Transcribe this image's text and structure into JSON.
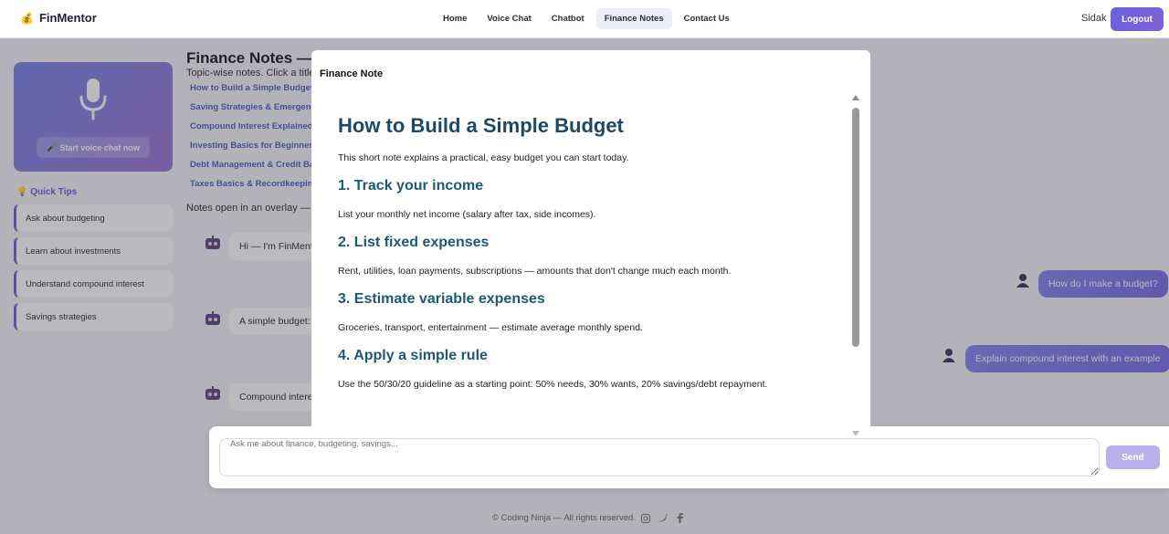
{
  "header": {
    "brand": "FinMentor",
    "nav": [
      "Home",
      "Voice Chat",
      "Chatbot",
      "Finance Notes",
      "Contact Us"
    ],
    "active_tab": "Finance Notes",
    "user_name": "Sidak",
    "logout_label": "Logout"
  },
  "voice_card": {
    "button_label": "Start voice chat now"
  },
  "quick_tips": {
    "title": "Quick Tips",
    "items": [
      "Ask about budgeting",
      "Learn about investments",
      "Understand compound interest",
      "Savings strategies"
    ]
  },
  "notes": {
    "title": "Finance Notes — I",
    "subtitle": "Topic-wise notes. Click a title",
    "topics": [
      "How to Build a Simple Budget",
      "Saving Strategies & Emergency",
      "Compound Interest Explained",
      "Investing Basics for Beginners",
      "Debt Management & Credit Bas",
      "Taxes Basics & Recordkeeping"
    ],
    "footer_text": "Notes open in an overlay —"
  },
  "chat": {
    "bot_messages": [
      "Hi — I'm FinMentor",
      "A simple budget:",
      "Compound intere"
    ],
    "user_messages": [
      "How do I make a budget?",
      "Explain compound interest with an example"
    ]
  },
  "input": {
    "placeholder": "Ask me about finance, budgeting, savings...",
    "send_label": "Send"
  },
  "footer": {
    "copyright": "© Coding Ninja — All rights reserved"
  },
  "modal": {
    "header": "Finance Note",
    "title": "How to Build a Simple Budget",
    "intro": "This short note explains a practical, easy budget you can start today.",
    "sections": [
      {
        "heading": "1. Track your income",
        "body": "List your monthly net income (salary after tax, side incomes)."
      },
      {
        "heading": "2. List fixed expenses",
        "body": "Rent, utilities, loan payments, subscriptions — amounts that don't change much each month."
      },
      {
        "heading": "3. Estimate variable expenses",
        "body": "Groceries, transport, entertainment — estimate average monthly spend."
      },
      {
        "heading": "4. Apply a simple rule",
        "body": "Use the 50/30/20 guideline as a starting point: 50% needs, 30% wants, 20% savings/debt repayment."
      }
    ]
  }
}
